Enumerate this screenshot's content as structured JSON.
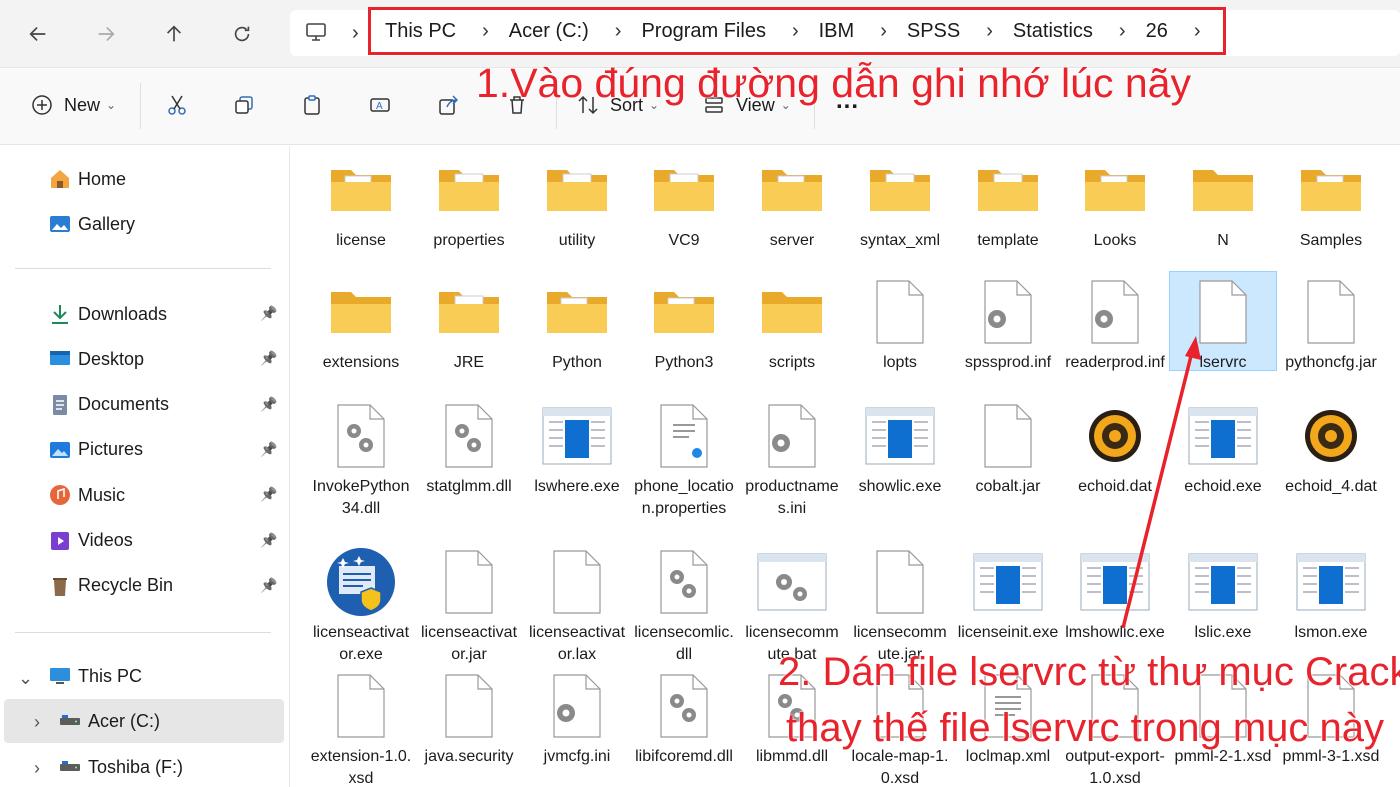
{
  "nav": {
    "back": "back-arrow-icon",
    "forward": "forward-arrow-icon",
    "up": "up-arrow-icon",
    "refresh": "refresh-icon"
  },
  "breadcrumb": [
    "This PC",
    "Acer (C:)",
    "Program Files",
    "IBM",
    "SPSS",
    "Statistics",
    "26"
  ],
  "commands": {
    "new_label": "New",
    "sort_label": "Sort",
    "view_label": "View",
    "more_label": "..."
  },
  "annotations": {
    "step1": "1.Vào đúng đường dẫn ghi nhớ lúc nãy",
    "step2_line1": "2. Dán file lservrc từ thư mục Crack",
    "step2_line2": "thay thế file lservrc trong mục này"
  },
  "sidebar": {
    "home": "Home",
    "gallery": "Gallery",
    "quick": [
      "Downloads",
      "Desktop",
      "Documents",
      "Pictures",
      "Music",
      "Videos",
      "Recycle Bin"
    ],
    "this_pc": "This PC",
    "drives": [
      "Acer (C:)",
      "Toshiba (F:)"
    ]
  },
  "files": [
    [
      "license",
      "properties",
      "utility",
      "VC9",
      "server",
      "syntax_xml",
      "template",
      "Looks",
      "N",
      "Samples"
    ],
    [
      "extensions",
      "JRE",
      "Python",
      "Python3",
      "scripts",
      "lopts",
      "spssprod.inf",
      "readerprod.inf",
      "lservrc",
      "pythoncfg.jar"
    ],
    [
      "InvokePython34.dll",
      "statglmm.dll",
      "lswhere.exe",
      "phone_location.properties",
      "productnames.ini",
      "showlic.exe",
      "cobalt.jar",
      "echoid.dat",
      "echoid.exe",
      "echoid_4.dat"
    ],
    [
      "licenseactivator.exe",
      "licenseactivator.jar",
      "licenseactivator.lax",
      "licensecomlic.dll",
      "licensecommute.bat",
      "licensecommute.jar",
      "licenseinit.exe",
      "lmshowlic.exe",
      "lslic.exe",
      "lsmon.exe"
    ],
    [
      "extension-1.0.xsd",
      "java.security",
      "jvmcfg.ini",
      "libifcoremd.dll",
      "libmmd.dll",
      "locale-map-1.0.xsd",
      "loclmap.xml",
      "output-export-1.0.xsd",
      "pmml-2-1.xsd",
      "pmml-3-1.xsd"
    ]
  ],
  "selected_file": "lservrc",
  "colors": {
    "annotation": "#e8232b",
    "selection": "#cce8ff",
    "folder": "#f7c948"
  }
}
